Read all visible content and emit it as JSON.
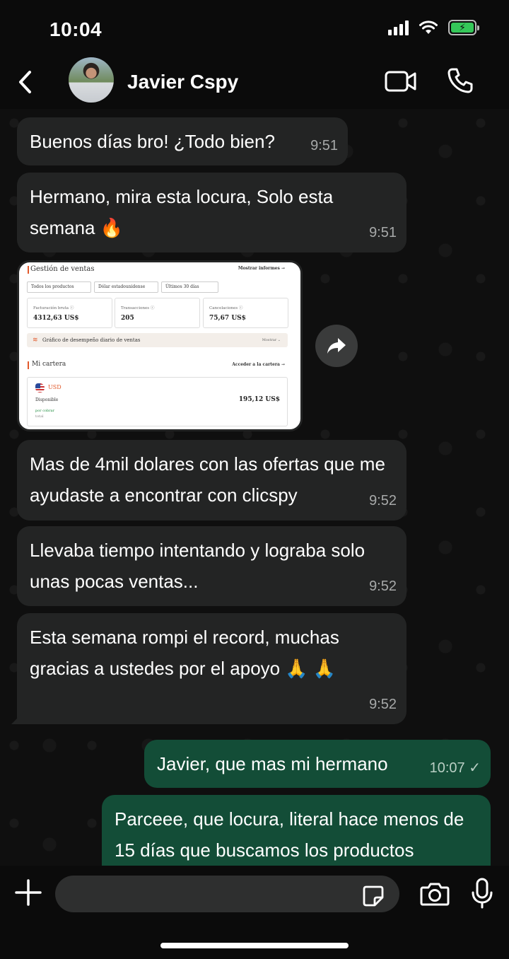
{
  "status_bar": {
    "time": "10:04"
  },
  "header": {
    "contact_name": "Javier Cspy"
  },
  "messages": [
    {
      "text": "Buenos días bro! ¿Todo bien?",
      "time": "9:51"
    },
    {
      "text": "Hermano, mira esta locura, Solo esta semana 🔥",
      "time": "9:51"
    },
    {
      "text": "Mas de 4mil dolares con las ofertas que me ayudaste a encontrar con clicspy",
      "time": "9:52"
    },
    {
      "text": "Llevaba tiempo intentando y lograba solo unas pocas ventas...",
      "time": "9:52"
    },
    {
      "text": "Esta semana rompi el record, muchas gracias a ustedes por el apoyo 🙏 🙏",
      "time": "9:52"
    },
    {
      "text": "Javier, que mas mi hermano",
      "time": "10:07"
    },
    {
      "text": "Parceee, que locura, literal hace menos de 15 días que buscamos los productos",
      "time": ""
    }
  ],
  "screenshot": {
    "title": "Gestión de ventas",
    "show_reports": "Mostrar informes →",
    "filters": [
      "Todos los productos",
      "Dólar estadounidense",
      "Últimos 30 días"
    ],
    "cards": [
      {
        "label": "Facturación bruta ⓘ",
        "value": "4312,63 US$"
      },
      {
        "label": "Transacciones ⓘ",
        "value": "205"
      },
      {
        "label": "Cancelaciones ⓘ",
        "value": "75,67 US$"
      }
    ],
    "banner": "Gráfico de desempeño diario de ventas",
    "banner_action": "Mostrar ⌄",
    "wallet_title": "Mi cartera",
    "wallet_link": "Acceder a la cartera →",
    "currency": "USD",
    "available_label": "Disponible",
    "available_value": "195,12 US$",
    "pending_label": "por cobrar",
    "total_label": "total"
  },
  "input": {
    "placeholder": ""
  },
  "colors": {
    "incoming_bubble": "#232424",
    "outgoing_bubble": "#134d37",
    "read_tick": "#b9cfc4"
  }
}
